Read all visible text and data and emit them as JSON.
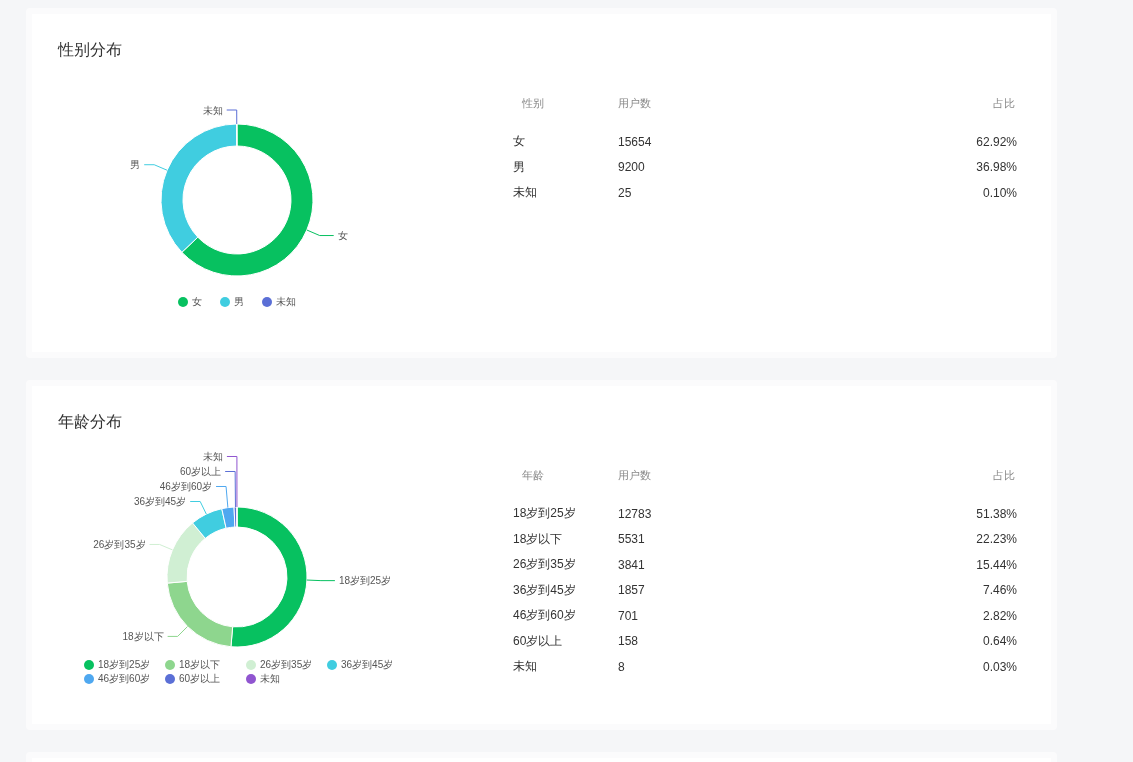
{
  "sections": [
    {
      "title": "性别分布",
      "chart_data": {
        "type": "donut",
        "categories": [
          "女",
          "男",
          "未知"
        ],
        "values": [
          62.92,
          36.98,
          0.1
        ],
        "colors": [
          "#07c160",
          "#40cde0",
          "#5b6fd6"
        ]
      },
      "legend": [
        {
          "label": "女",
          "color": "#07c160"
        },
        {
          "label": "男",
          "color": "#40cde0"
        },
        {
          "label": "未知",
          "color": "#5b6fd6"
        }
      ],
      "table": {
        "columns": [
          "性别",
          "用户数",
          "占比"
        ],
        "rows": [
          [
            "女",
            "15654",
            "62.92%"
          ],
          [
            "男",
            "9200",
            "36.98%"
          ],
          [
            "未知",
            "25",
            "0.10%"
          ]
        ]
      }
    },
    {
      "title": "年龄分布",
      "chart_data": {
        "type": "donut",
        "categories": [
          "18岁到25岁",
          "18岁以下",
          "26岁到35岁",
          "36岁到45岁",
          "46岁到60岁",
          "60岁以上",
          "未知"
        ],
        "values": [
          51.38,
          22.23,
          15.44,
          7.46,
          2.82,
          0.64,
          0.03
        ],
        "colors": [
          "#07c160",
          "#8ed68e",
          "#d0efd3",
          "#40cde0",
          "#4fa8f0",
          "#5b6fd6",
          "#9055d0"
        ]
      },
      "legend": [
        {
          "label": "18岁到25岁",
          "color": "#07c160"
        },
        {
          "label": "18岁以下",
          "color": "#8ed68e"
        },
        {
          "label": "26岁到35岁",
          "color": "#d0efd3"
        },
        {
          "label": "36岁到45岁",
          "color": "#40cde0"
        },
        {
          "label": "46岁到60岁",
          "color": "#4fa8f0"
        },
        {
          "label": "60岁以上",
          "color": "#5b6fd6"
        },
        {
          "label": "未知",
          "color": "#9055d0"
        }
      ],
      "table": {
        "columns": [
          "年龄",
          "用户数",
          "占比"
        ],
        "rows": [
          [
            "18岁到25岁",
            "12783",
            "51.38%"
          ],
          [
            "18岁以下",
            "5531",
            "22.23%"
          ],
          [
            "26岁到35岁",
            "3841",
            "15.44%"
          ],
          [
            "36岁到45岁",
            "1857",
            "7.46%"
          ],
          [
            "46岁到60岁",
            "701",
            "2.82%"
          ],
          [
            "60岁以上",
            "158",
            "0.64%"
          ],
          [
            "未知",
            "8",
            "0.03%"
          ]
        ]
      }
    }
  ]
}
